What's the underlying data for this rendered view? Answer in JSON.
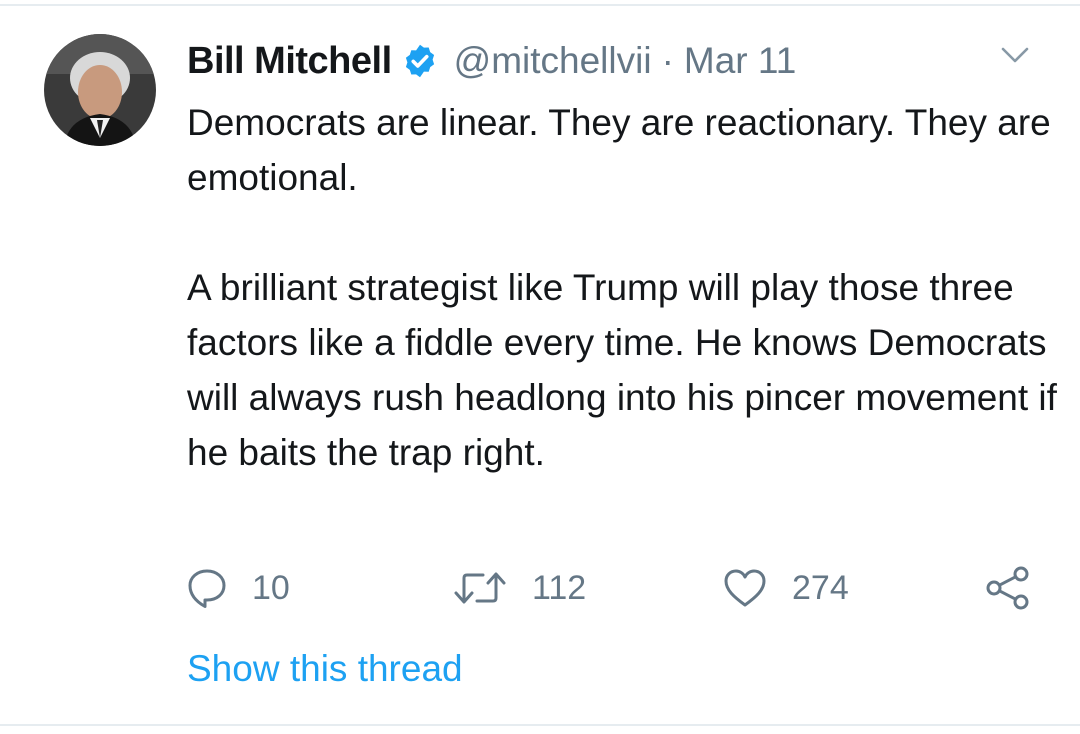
{
  "tweet": {
    "author_name": "Bill Mitchell",
    "handle": "@mitchellvii",
    "separator": "·",
    "date": "Mar 11",
    "paragraphs": [
      "Democrats are linear. They are reactionary. They are emotional.",
      "A brilliant strategist like Trump will play those three factors like a fiddle every time. He knows Democrats will always rush headlong into his pincer movement if he baits the trap right."
    ],
    "reply_count": "10",
    "retweet_count": "112",
    "like_count": "274",
    "thread_link": "Show this thread"
  },
  "icons": {
    "verified": "verified-badge-icon",
    "caret": "chevron-down-icon",
    "reply": "reply-icon",
    "retweet": "retweet-icon",
    "like": "heart-icon",
    "share": "share-icon"
  },
  "colors": {
    "text": "#14171a",
    "secondary": "#657786",
    "accent": "#1da1f2",
    "divider": "#e6ecf0"
  }
}
